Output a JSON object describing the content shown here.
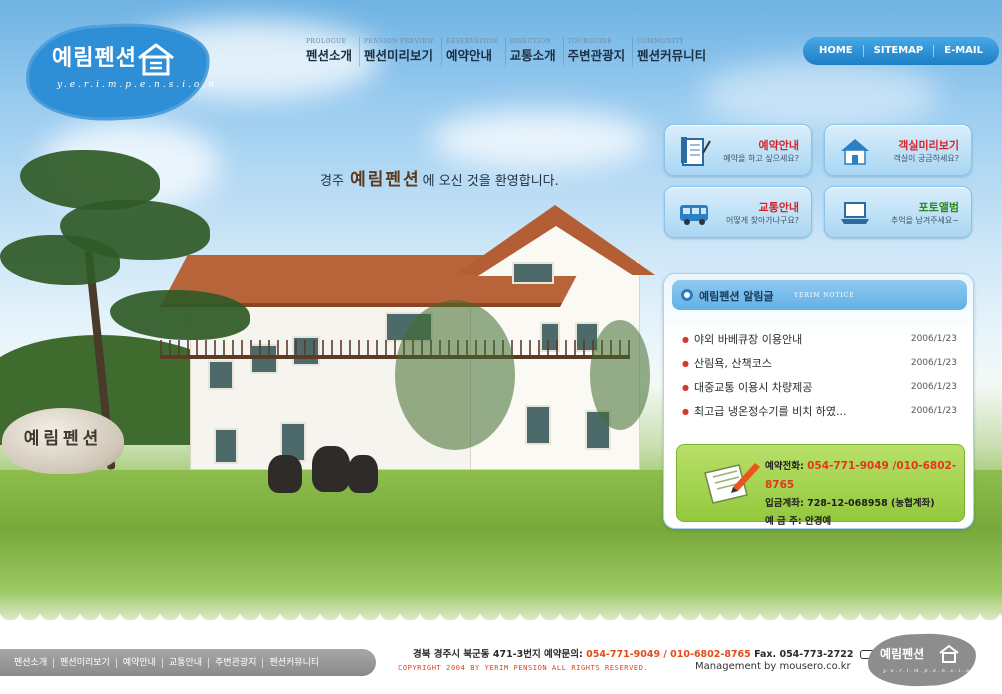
{
  "logo": {
    "title": "예림펜션",
    "subtitle": "y.e.r.i.m.p.e.n.s.i.o.n",
    "icon": "home-icon"
  },
  "nav": [
    {
      "eng": "PROLOGUE",
      "label": "펜션소개"
    },
    {
      "eng": "PENSION PREVIEW",
      "label": "펜션미리보기"
    },
    {
      "eng": "RESERVATION",
      "label": "예약안내"
    },
    {
      "eng": "DIRECTION",
      "label": "교통소개"
    },
    {
      "eng": "TOURGUIDE",
      "label": "주변관광지"
    },
    {
      "eng": "COMMUNITY",
      "label": "펜션커뮤니티"
    }
  ],
  "utility": {
    "home": "HOME",
    "sitemap": "SITEMAP",
    "email": "E-MAIL"
  },
  "welcome": {
    "prefix": "경주",
    "name": "예림펜션",
    "suffix": "에 오신 것을 환영합니다."
  },
  "stone_sign": "예림펜션",
  "quick_buttons": [
    {
      "title": "예약안내",
      "desc": "예약을 하고 싶으세요?",
      "icon": "document-icon"
    },
    {
      "title": "객실미리보기",
      "desc": "객실이 궁금하세요?",
      "icon": "house-icon"
    },
    {
      "title": "교통안내",
      "desc": "어떻게 찾아가나구요?",
      "icon": "bus-icon"
    },
    {
      "title": "포토앨범",
      "desc": "추억을 남겨주세요~",
      "icon": "laptop-icon"
    }
  ],
  "notice": {
    "title": "예림펜션 알림글",
    "subtitle": "YERIM NOTICE",
    "items": [
      {
        "title": "야외 바베큐장 이용안내",
        "date": "2006/1/23"
      },
      {
        "title": "산림욕, 산책코스",
        "date": "2006/1/23"
      },
      {
        "title": "대중교통 이용시 차량제공",
        "date": "2006/1/23"
      },
      {
        "title": "최고급 냉온정수기를 비치 하였...",
        "date": "2006/1/23"
      }
    ]
  },
  "contact": {
    "phone_label": "예약전화:",
    "phone_value": "054-771-9049 /010-6802-8765",
    "account_label": "입금계좌:",
    "account_value": "728-12-068958 (농협계좌)",
    "holder_label": "예 금 주:",
    "holder_value": "안경예"
  },
  "footer": {
    "nav": [
      "펜션소개",
      "펜션미리보기",
      "예약안내",
      "교통안내",
      "주변관광지",
      "펜션커뮤니티"
    ],
    "address": "경북 경주시 북군동 471-3번지 예약문의:",
    "phones": "054-771-9049 / 010-6802-8765",
    "fax": "Fax. 054-773-2722",
    "copyright": "COPYRIGHT 2004 BY YERIM PENSION ALL RIGHTS RESERVED.",
    "management": "Management by mousero.co.kr",
    "logo_title": "예림펜션",
    "logo_sub": "y.e.r.i.m.p.e.n.s.i.o.n"
  },
  "colors": {
    "sky": "#9ccdf0",
    "logo_blue": "#2f8fd6",
    "nav_text": "#1b2f45",
    "accent_red": "#d6262b",
    "contact_green": "#93c83c",
    "footer_gray": "#8a8a8a"
  }
}
